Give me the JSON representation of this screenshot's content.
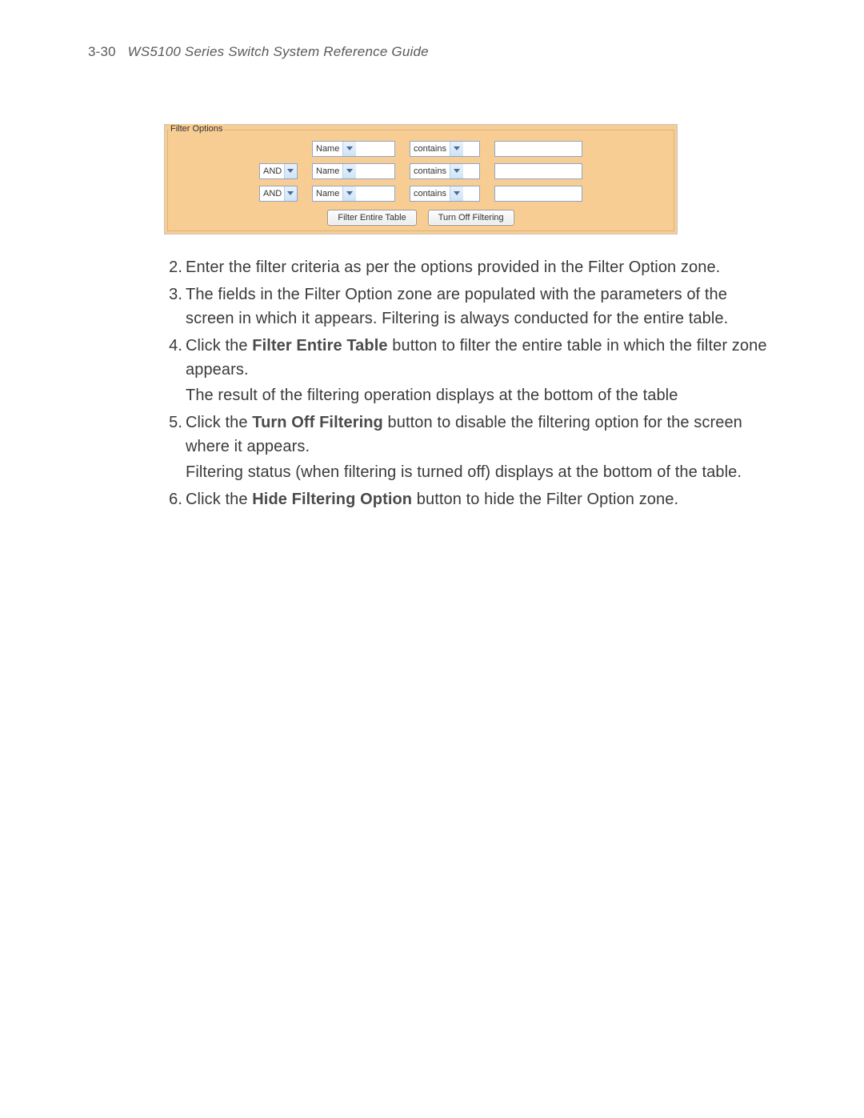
{
  "header": {
    "page_number": "3-30",
    "title": "WS5100 Series Switch System Reference Guide"
  },
  "filter_panel": {
    "legend": "Filter Options",
    "rows": [
      {
        "logic": "",
        "field": "Name",
        "op": "contains",
        "value": ""
      },
      {
        "logic": "AND",
        "field": "Name",
        "op": "contains",
        "value": ""
      },
      {
        "logic": "AND",
        "field": "Name",
        "op": "contains",
        "value": ""
      }
    ],
    "buttons": {
      "filter_entire_table": "Filter Entire Table",
      "turn_off_filtering": "Turn Off Filtering"
    }
  },
  "steps": [
    {
      "n": "2.",
      "runs": [
        [
          {
            "t": "Enter the filter criteria as per the options provided in the Filter Option zone."
          }
        ]
      ]
    },
    {
      "n": "3.",
      "runs": [
        [
          {
            "t": "The fields in the Filter Option zone are populated with the parameters of the screen in which it appears. Filtering is always conducted for the entire table."
          }
        ]
      ]
    },
    {
      "n": "4.",
      "runs": [
        [
          {
            "t": "Click the "
          },
          {
            "t": "Filter Entire Table",
            "b": true
          },
          {
            "t": " button to filter the entire table in which the filter zone appears."
          }
        ],
        [
          {
            "t": "The result of the filtering operation displays at the bottom of the table"
          }
        ]
      ]
    },
    {
      "n": "5.",
      "runs": [
        [
          {
            "t": "Click the "
          },
          {
            "t": "Turn Off Filtering",
            "b": true
          },
          {
            "t": " button to disable the filtering option for the screen where it appears."
          }
        ],
        [
          {
            "t": "Filtering status (when filtering is turned off) displays at the bottom of the table."
          }
        ]
      ]
    },
    {
      "n": "6.",
      "runs": [
        [
          {
            "t": "Click the "
          },
          {
            "t": "Hide Filtering Option",
            "b": true
          },
          {
            "t": " button to hide the Filter Option zone."
          }
        ]
      ]
    }
  ]
}
